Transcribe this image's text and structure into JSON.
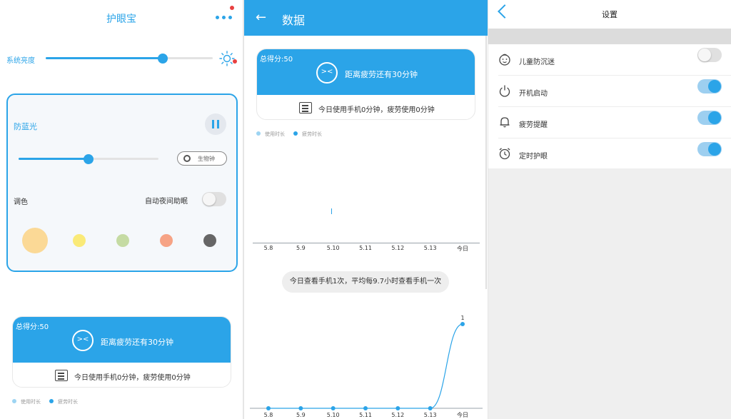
{
  "colors": {
    "accent": "#2ba4e8",
    "light_accent": "#9dd4f2",
    "alert": "#e84040"
  },
  "eye_screen": {
    "title": "护眼宝",
    "more_icon": "more-horizontal-icon",
    "brightness": {
      "label": "系统亮度",
      "level": 0.7,
      "icon": "sun-icon"
    },
    "blue_light": {
      "label": "防蓝光",
      "level": 0.5,
      "pause_icon": "pause-icon",
      "bio_clock_label": "生物钟",
      "tone_label": "调色",
      "night_assist_label": "自动夜间助眠",
      "night_assist_on": false,
      "swatches": [
        "#fbd996",
        "#faea78",
        "#c5dba3",
        "#f6a385",
        "#666666"
      ]
    },
    "score_card": {
      "score_text": "总得分:50",
      "fatigue_text": "距离疲劳还有30分钟",
      "usage_text": "今日使用手机0分钟，疲劳使用0分钟"
    },
    "legend": {
      "usage": "使用时长",
      "fatigue": "疲劳时长"
    }
  },
  "data_screen": {
    "title": "数据",
    "back_icon": "back-arrow-icon",
    "score_card": {
      "score_text": "总得分:50",
      "fatigue_text": "距离疲劳还有30分钟",
      "usage_text": "今日使用手机0分钟，疲劳使用0分钟"
    },
    "legend": {
      "usage": "使用时长",
      "fatigue": "疲劳时长"
    },
    "check_summary": "今日查看手机1次，平均每9.7小时查看手机一次"
  },
  "chart_data": [
    {
      "type": "bar",
      "categories": [
        "5.8",
        "5.9",
        "5.10",
        "5.11",
        "5.12",
        "5.13",
        "今日"
      ],
      "series": [
        {
          "name": "使用时长",
          "values": [
            0,
            0,
            0,
            0,
            0,
            0,
            0
          ]
        },
        {
          "name": "疲劳时长",
          "values": [
            0,
            0,
            0,
            0,
            0,
            0,
            0
          ]
        }
      ],
      "title": "",
      "xlabel": "",
      "ylabel": "",
      "legend": "top-left"
    },
    {
      "type": "line",
      "categories": [
        "5.8",
        "5.9",
        "5.10",
        "5.11",
        "5.12",
        "5.13",
        "今日"
      ],
      "values": [
        0,
        0,
        0,
        0,
        0,
        0,
        1
      ],
      "data_labels": [
        "",
        "",
        "",
        "",
        "",
        "",
        "1"
      ],
      "title": "",
      "xlabel": "",
      "ylabel": "",
      "ylim": [
        0,
        1
      ]
    }
  ],
  "settings_screen": {
    "title": "设置",
    "back_icon": "chevron-left-icon",
    "items": [
      {
        "label": "儿童防沉迷",
        "icon": "child-face-icon",
        "on": false
      },
      {
        "label": "开机启动",
        "icon": "power-icon",
        "on": true
      },
      {
        "label": "疲劳提醒",
        "icon": "bell-icon",
        "on": true
      },
      {
        "label": "定时护眼",
        "icon": "alarm-clock-icon",
        "on": true
      }
    ]
  }
}
